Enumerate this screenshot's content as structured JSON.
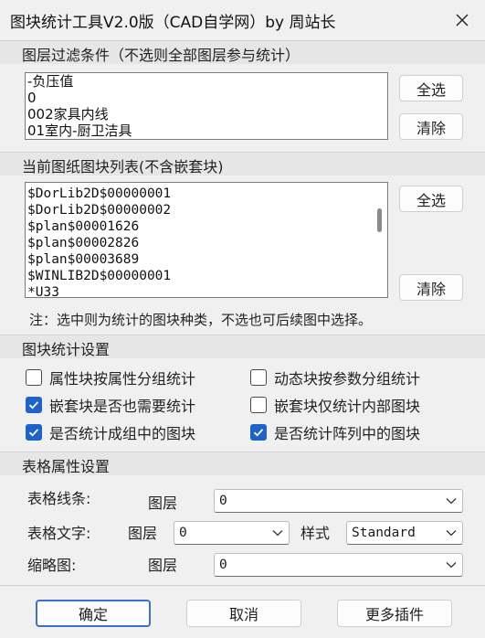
{
  "window": {
    "title": "图块统计工具V2.0版（CAD自学网）by 周站长"
  },
  "layer_filter": {
    "heading": "图层过滤条件（不选则全部图层参与统计）",
    "items": [
      "-负压值",
      "0",
      "002家具内线",
      "01室内-厨卫洁具"
    ],
    "select_all": "全选",
    "clear": "清除"
  },
  "block_list": {
    "heading": "当前图纸图块列表(不含嵌套块)",
    "items": [
      "$DorLib2D$00000001",
      "$DorLib2D$00000002",
      "$plan$00001626",
      "$plan$00002826",
      "$plan$00003689",
      "$WINLIB2D$00000001",
      "*U33"
    ],
    "select_all": "全选",
    "clear": "清除",
    "note": "注：选中则为统计的图块种类，不选也可后续图中选择。"
  },
  "stats_settings": {
    "heading": "图块统计设置",
    "options": [
      {
        "label": "属性块按属性分组统计",
        "checked": false
      },
      {
        "label": "动态块按参数分组统计",
        "checked": false
      },
      {
        "label": "嵌套块是否也需要统计",
        "checked": true
      },
      {
        "label": "嵌套块仅统计内部图块",
        "checked": false
      },
      {
        "label": "是否统计成组中的图块",
        "checked": true
      },
      {
        "label": "是否统计阵列中的图块",
        "checked": true
      }
    ]
  },
  "table_settings": {
    "heading": "表格属性设置",
    "line_label": "表格线条:",
    "line_layer_label": "图层",
    "line_layer_value": "0",
    "text_label": "表格文字:",
    "text_layer_label": "图层",
    "text_layer_value": "0",
    "text_style_label": "样式",
    "text_style_value": "Standard",
    "thumb_label": "缩略图:",
    "thumb_layer_label": "图层",
    "thumb_layer_value": "0"
  },
  "footer": {
    "ok": "确定",
    "cancel": "取消",
    "more": "更多插件"
  },
  "colors": {
    "accent": "#1f63c9",
    "background": "#f0f0f0",
    "section": "#e6e6e6"
  }
}
